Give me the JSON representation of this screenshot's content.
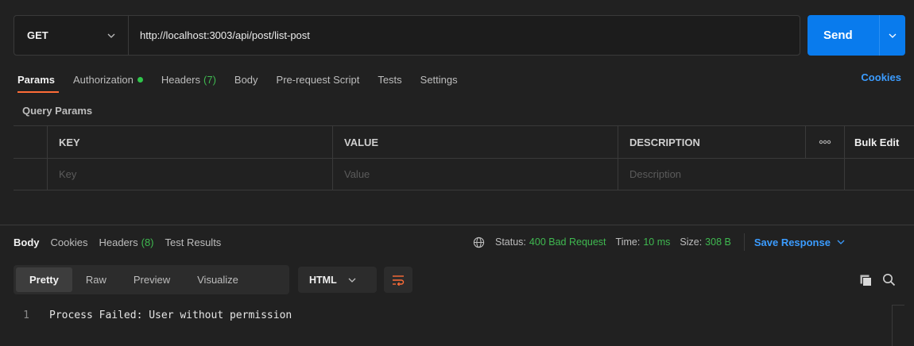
{
  "request": {
    "method": "GET",
    "url": "http://localhost:3003/api/post/list-post",
    "send_label": "Send"
  },
  "request_tabs": [
    {
      "label": "Params",
      "active": true
    },
    {
      "label": "Authorization",
      "dot": true
    },
    {
      "label": "Headers",
      "count": "(7)"
    },
    {
      "label": "Body"
    },
    {
      "label": "Pre-request Script"
    },
    {
      "label": "Tests"
    },
    {
      "label": "Settings"
    }
  ],
  "cookies_label": "Cookies",
  "query_params": {
    "title": "Query Params",
    "columns": [
      "KEY",
      "VALUE",
      "DESCRIPTION"
    ],
    "more_label": "ooo",
    "bulk_edit_label": "Bulk Edit",
    "placeholders": [
      "Key",
      "Value",
      "Description"
    ]
  },
  "response_tabs": [
    {
      "label": "Body",
      "active": true
    },
    {
      "label": "Cookies"
    },
    {
      "label": "Headers",
      "count": "(8)"
    },
    {
      "label": "Test Results"
    }
  ],
  "status": {
    "status_label": "Status:",
    "status_value": "400 Bad Request",
    "time_label": "Time:",
    "time_value": "10 ms",
    "size_label": "Size:",
    "size_value": "308 B",
    "save_label": "Save Response"
  },
  "view_modes": [
    {
      "label": "Pretty",
      "active": true
    },
    {
      "label": "Raw"
    },
    {
      "label": "Preview"
    },
    {
      "label": "Visualize"
    }
  ],
  "format": "HTML",
  "response_body": {
    "line_number": "1",
    "text": "Process Failed: User without permission"
  },
  "colors": {
    "accent": "#097bed",
    "tab_underline": "#ff6c37",
    "success": "#3fb950",
    "link": "#3b9cff"
  }
}
